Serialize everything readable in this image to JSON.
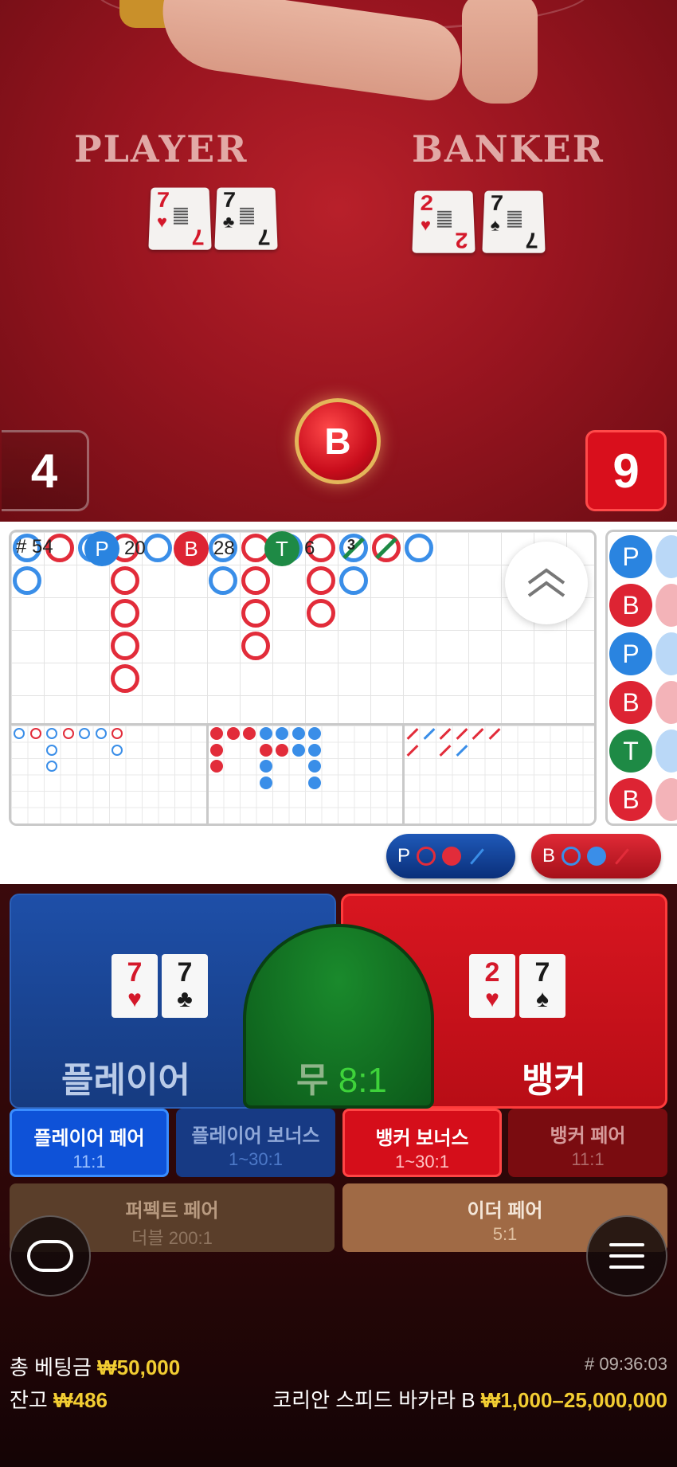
{
  "video": {
    "player_label": "PLAYER",
    "banker_label": "BANKER",
    "player_cards": [
      {
        "rank": "7",
        "suit": "♥",
        "color": "#d4182a"
      },
      {
        "rank": "7",
        "suit": "♣",
        "color": "#1a1a1a"
      }
    ],
    "banker_cards": [
      {
        "rank": "2",
        "suit": "♥",
        "color": "#d4182a"
      },
      {
        "rank": "7",
        "suit": "♠",
        "color": "#1a1a1a"
      }
    ],
    "player_score": "4",
    "banker_score": "9",
    "winner_badge": "B"
  },
  "roadmap": {
    "column_toggle_icon": "chevron-double-up-icon",
    "big_eye_balls": [
      "P",
      "B",
      "P",
      "B",
      "T",
      "B"
    ],
    "tie_marker": "3"
  },
  "stats": {
    "hash_count": "# 54",
    "player_letter": "P",
    "player_count": "20",
    "banker_letter": "B",
    "banker_count": "28",
    "tie_letter": "T",
    "tie_count": "6"
  },
  "ask": {
    "player_letter": "P",
    "banker_letter": "B"
  },
  "bets": {
    "player_label": "플레이어",
    "tie_label": "무",
    "tie_odds": "8:1",
    "banker_label": "뱅커",
    "player_pair_label": "플레이어 페어",
    "player_pair_odds": "11:1",
    "player_bonus_label": "플레이어 보너스",
    "player_bonus_odds": "1~30:1",
    "banker_bonus_label": "뱅커 보너스",
    "banker_bonus_odds": "1~30:1",
    "banker_pair_label": "뱅커 페어",
    "banker_pair_odds": "11:1",
    "perfect_pair_label": "퍼펙트 페어",
    "perfect_pair_odds": "더블 200:1",
    "either_pair_label": "이더 페어",
    "either_pair_odds": "5:1"
  },
  "footer": {
    "total_bet_label": "총 베팅금",
    "total_bet_value": "₩50,000",
    "balance_label": "잔고",
    "balance_value": "₩486",
    "time": "# 09:36:03",
    "table_name": "코리안 스피드 바카라 B",
    "table_limits": "₩1,000–25,000,000"
  },
  "colors": {
    "player_blue": "#2a84e0",
    "banker_red": "#dd2433",
    "tie_green": "#1e8a45",
    "gold": "#f2cd32"
  }
}
